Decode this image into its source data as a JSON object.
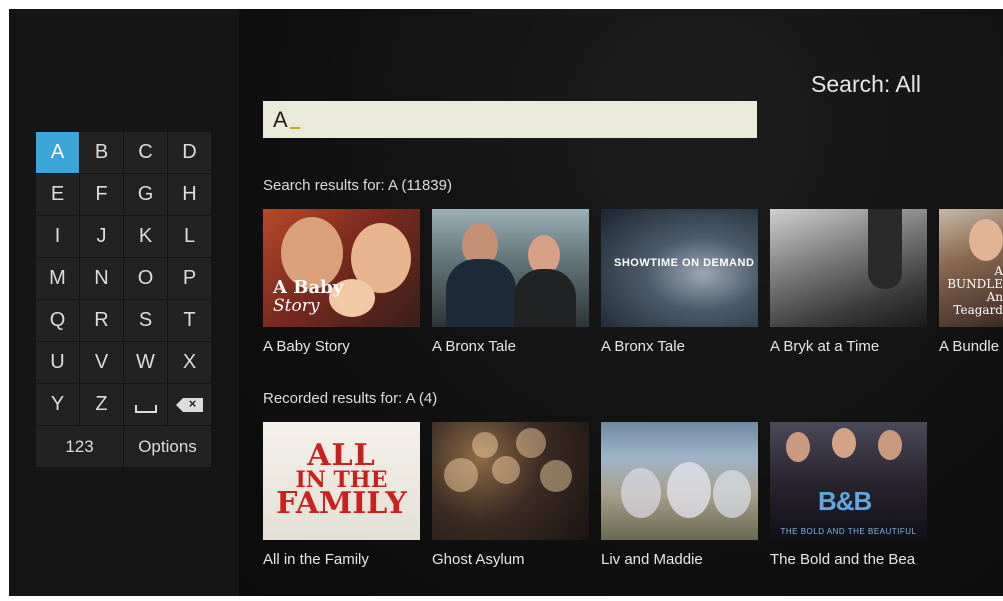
{
  "header": {
    "title": "Search: All"
  },
  "search": {
    "query": "A"
  },
  "keyboard": {
    "keys": [
      "A",
      "B",
      "C",
      "D",
      "E",
      "F",
      "G",
      "H",
      "I",
      "J",
      "K",
      "L",
      "M",
      "N",
      "O",
      "P",
      "Q",
      "R",
      "S",
      "T",
      "U",
      "V",
      "W",
      "X",
      "Y",
      "Z"
    ],
    "numbers_label": "123",
    "options_label": "Options",
    "active_key": "A"
  },
  "search_results": {
    "label": "Search results for:  A (11839)",
    "items": [
      {
        "title": "A Baby Story",
        "art_text_1": "A Baby",
        "art_text_2": "Story"
      },
      {
        "title": "A Bronx Tale"
      },
      {
        "title": "A Bronx Tale",
        "art_text": "SHOWTIME ON DEMAND"
      },
      {
        "title": "A Bryk at a Time"
      },
      {
        "title": "A Bundle",
        "art_text": "A BUNDLE An Teagard"
      }
    ]
  },
  "recorded_results": {
    "label": "Recorded results for:  A (4)",
    "items": [
      {
        "title": "All in the Family",
        "art_text_1": "ALL",
        "art_text_2": "IN THE",
        "art_text_3": "FAMILY"
      },
      {
        "title": "Ghost Asylum"
      },
      {
        "title": "Liv and Maddie"
      },
      {
        "title": "The Bold and the Bea",
        "art_logo": "B&B",
        "art_sub": "THE BOLD AND THE BEAUTIFUL"
      }
    ]
  },
  "colors": {
    "accent": "#3aa6d9",
    "search_box": "#e9ead9",
    "background": "#0d0d0d"
  }
}
